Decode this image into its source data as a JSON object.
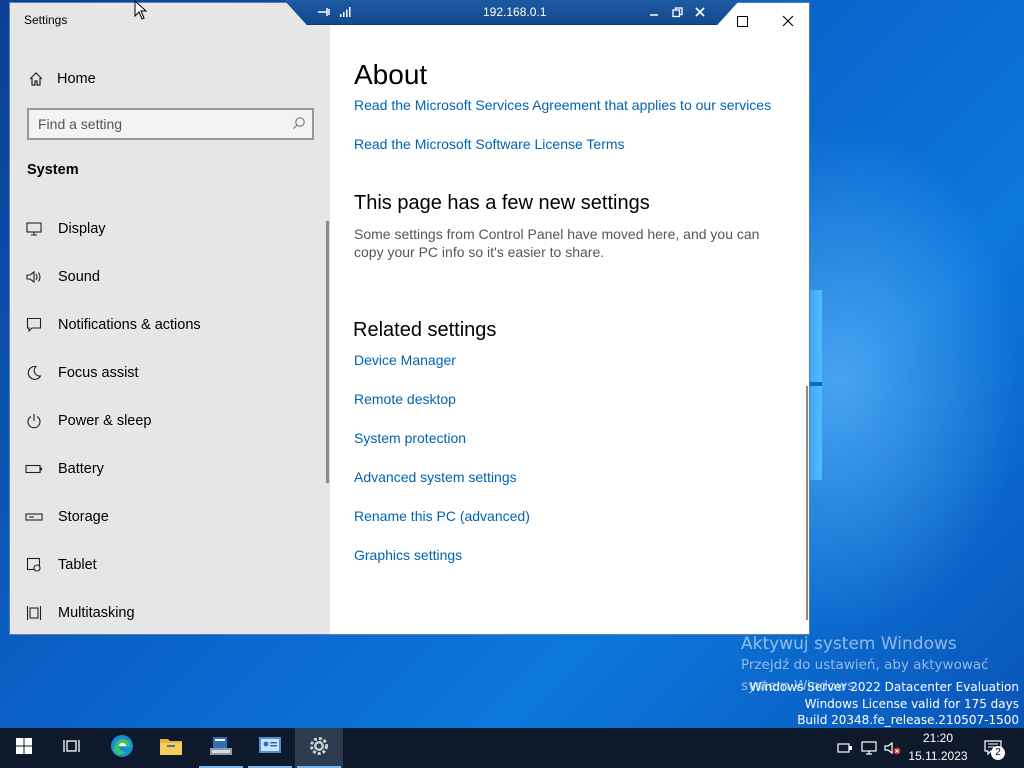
{
  "desktop": {
    "watermark_title": "Aktywuj system Windows",
    "watermark_line1": "Przejdź do ustawień, aby aktywować",
    "watermark_line2": "system Windows.",
    "server_line1": "Windows Server 2022 Datacenter Evaluation",
    "server_line2": "Windows License valid for 175 days",
    "server_line3": "Build 20348.fe_release.210507-1500"
  },
  "rdp_bar": {
    "host": "192.168.0.1",
    "icons": [
      "pin-icon",
      "signal-icon",
      "minimize-icon",
      "restore-icon",
      "close-icon"
    ]
  },
  "settings": {
    "window_title": "Settings",
    "home_label": "Home",
    "search_placeholder": "Find a setting",
    "section_label": "System",
    "nav_items": [
      {
        "label": "Display",
        "icon": "display-icon"
      },
      {
        "label": "Sound",
        "icon": "sound-icon"
      },
      {
        "label": "Notifications & actions",
        "icon": "notifications-icon"
      },
      {
        "label": "Focus assist",
        "icon": "moon-icon"
      },
      {
        "label": "Power & sleep",
        "icon": "power-icon"
      },
      {
        "label": "Battery",
        "icon": "battery-icon"
      },
      {
        "label": "Storage",
        "icon": "storage-icon"
      },
      {
        "label": "Tablet",
        "icon": "tablet-icon"
      },
      {
        "label": "Multitasking",
        "icon": "multitasking-icon"
      }
    ],
    "content": {
      "title": "About",
      "link_services": "Read the Microsoft Services Agreement that applies to our services",
      "link_license": "Read the Microsoft Software License Terms",
      "new_settings_heading": "This page has a few new settings",
      "new_settings_desc": "Some settings from Control Panel have moved here, and you can copy your PC info so it's easier to share.",
      "related_heading": "Related settings",
      "related_links": [
        "Device Manager",
        "Remote desktop",
        "System protection",
        "Advanced system settings",
        "Rename this PC (advanced)",
        "Graphics settings"
      ]
    }
  },
  "taskbar": {
    "time": "21:20",
    "date": "15.11.2023",
    "notification_count": "2",
    "apps": [
      "start-icon",
      "task-view-icon",
      "edge-icon",
      "file-explorer-icon",
      "server-manager-icon",
      "control-panel-icon",
      "settings-icon"
    ]
  }
}
